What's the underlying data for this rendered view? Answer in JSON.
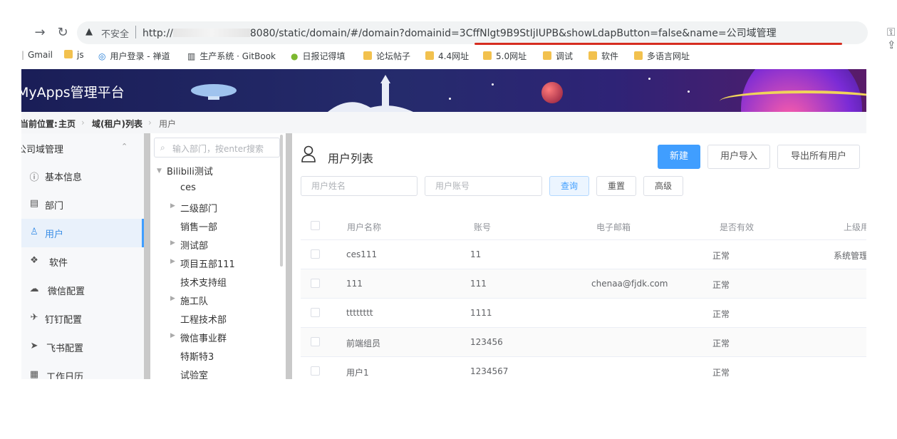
{
  "browser": {
    "insecure_label": "不安全",
    "url_prefix": "http://",
    "url_rest": "8080/static/domain/#/domain?domainid=3CffNlgt9B9StIjIUPB&showLdapButton=false&name=公司域管理"
  },
  "bookmarks": [
    {
      "label": "Gmail"
    },
    {
      "label": "js"
    },
    {
      "label": "用户登录 - 禅道"
    },
    {
      "label": "生产系统 · GitBook"
    },
    {
      "label": "日报记得填"
    },
    {
      "label": "论坛帖子"
    },
    {
      "label": "4.4网址"
    },
    {
      "label": "5.0网址"
    },
    {
      "label": "调试"
    },
    {
      "label": "软件"
    },
    {
      "label": "多语言网址"
    }
  ],
  "app": {
    "brand": "MyApps管理平台",
    "colors": {
      "accent": "#409eff",
      "banner": "#1f2560",
      "active_bg": "#e9f1fb",
      "red_underline": "#d62d20"
    }
  },
  "breadcrumb": {
    "prefix": "当前位置:",
    "items": [
      "主页",
      "域(租户)列表",
      "用户"
    ]
  },
  "menu": {
    "header": "公司域管理",
    "items": [
      {
        "label": "基本信息",
        "icon": "info-icon"
      },
      {
        "label": "部门",
        "icon": "building-icon"
      },
      {
        "label": "用户",
        "icon": "user-icon",
        "active": true
      },
      {
        "label": "软件",
        "icon": "cubes-icon"
      },
      {
        "label": "微信配置",
        "icon": "wechat-icon"
      },
      {
        "label": "钉钉配置",
        "icon": "plane-icon"
      },
      {
        "label": "飞书配置",
        "icon": "send-icon"
      },
      {
        "label": "工作日历",
        "icon": "calendar-icon"
      }
    ]
  },
  "tree": {
    "search_placeholder": "输入部门，按enter搜索",
    "root": "Bilibili测试",
    "nodes": [
      {
        "label": "ces",
        "expandable": false
      },
      {
        "label": "二级部门",
        "expandable": true
      },
      {
        "label": "销售一部",
        "expandable": false
      },
      {
        "label": "测试部",
        "expandable": true
      },
      {
        "label": "项目五部111",
        "expandable": true
      },
      {
        "label": "技术支持组",
        "expandable": false
      },
      {
        "label": "施工队",
        "expandable": true
      },
      {
        "label": "工程技术部",
        "expandable": false
      },
      {
        "label": "微信事业群",
        "expandable": true
      },
      {
        "label": "特斯特3",
        "expandable": false
      },
      {
        "label": "试验室",
        "expandable": false
      }
    ]
  },
  "main": {
    "title": "用户列表",
    "new_button": "新建",
    "import_button": "用户导入",
    "export_button": "导出所有用户",
    "name_placeholder": "用户姓名",
    "account_placeholder": "用户账号",
    "query_button": "查询",
    "reset_button": "重置",
    "advanced_button": "高级",
    "columns": [
      "用户名称",
      "账号",
      "电子邮箱",
      "是否有效",
      "上级用"
    ],
    "rows": [
      {
        "name": "ces111",
        "account": "11",
        "email": "",
        "status": "正常",
        "superior": "系统管理"
      },
      {
        "name": "111",
        "account": "111",
        "email": "chenaa@fjdk.com",
        "status": "正常",
        "superior": ""
      },
      {
        "name": "tttttttt",
        "account": "1111",
        "email": "",
        "status": "正常",
        "superior": ""
      },
      {
        "name": "前端组员",
        "account": "123456",
        "email": "",
        "status": "正常",
        "superior": ""
      },
      {
        "name": "用户1",
        "account": "1234567",
        "email": "",
        "status": "正常",
        "superior": ""
      }
    ]
  }
}
